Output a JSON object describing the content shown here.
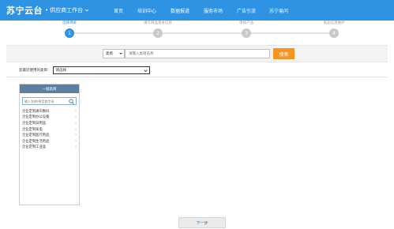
{
  "header": {
    "logo": "苏宁云台",
    "separator": "•",
    "supplier_label": "供应商工作台",
    "nav": [
      "首页",
      "培训中心",
      "数据报道",
      "服务市场",
      "广告引流",
      "苏宁易问"
    ],
    "bg_color": "#2f93e4"
  },
  "steps": [
    {
      "number": "1",
      "label": "选择目录",
      "active": true
    },
    {
      "number": "2",
      "label": "填写商品基本信息",
      "active": false
    },
    {
      "number": "3",
      "label": "审核产品",
      "active": false
    },
    {
      "number": "4",
      "label": "商品信息维护",
      "active": false
    }
  ],
  "search": {
    "select_value": "类目",
    "input_placeholder": "请输入类目名称",
    "button_label": "搜索",
    "button_color": "#f7941d"
  },
  "category_select": {
    "label": "您最近使用的类目：",
    "value": "请选择"
  },
  "panel": {
    "title": "一级类目",
    "search_placeholder": "输入名称/拼音首字母",
    "items": [
      "企业定制通讯数码",
      "企业定制办公设备",
      "企业定制日用品",
      "企业定制家电",
      "企业定制医疗用品",
      "企业定制生活用品",
      "企业定制工业品"
    ]
  },
  "next_button": "下一步"
}
